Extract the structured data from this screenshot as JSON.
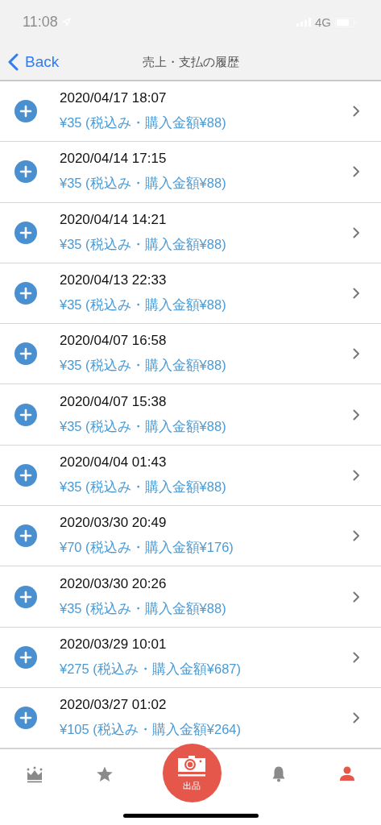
{
  "status_bar": {
    "time": "11:08",
    "network": "4G"
  },
  "nav": {
    "back": "Back",
    "title": "売上・支払の履歴"
  },
  "rows": [
    {
      "date": "2020/04/17 18:07",
      "amount": "¥35 (税込み・購入金額¥88)"
    },
    {
      "date": "2020/04/14 17:15",
      "amount": "¥35 (税込み・購入金額¥88)"
    },
    {
      "date": "2020/04/14 14:21",
      "amount": "¥35 (税込み・購入金額¥88)"
    },
    {
      "date": "2020/04/13 22:33",
      "amount": "¥35 (税込み・購入金額¥88)"
    },
    {
      "date": "2020/04/07 16:58",
      "amount": "¥35 (税込み・購入金額¥88)"
    },
    {
      "date": "2020/04/07 15:38",
      "amount": "¥35 (税込み・購入金額¥88)"
    },
    {
      "date": "2020/04/04 01:43",
      "amount": "¥35 (税込み・購入金額¥88)"
    },
    {
      "date": "2020/03/30 20:49",
      "amount": "¥70 (税込み・購入金額¥176)"
    },
    {
      "date": "2020/03/30 20:26",
      "amount": "¥35 (税込み・購入金額¥88)"
    },
    {
      "date": "2020/03/29 10:01",
      "amount": "¥275 (税込み・購入金額¥687)"
    },
    {
      "date": "2020/03/27 01:02",
      "amount": "¥105 (税込み・購入金額¥264)"
    }
  ],
  "tab_bar": [
    {
      "kind": "crown",
      "selected": false
    },
    {
      "kind": "star",
      "selected": false
    },
    {
      "kind": "camera",
      "label": "出品",
      "selected": false
    },
    {
      "kind": "bell",
      "selected": false
    },
    {
      "kind": "person",
      "selected": true
    }
  ]
}
